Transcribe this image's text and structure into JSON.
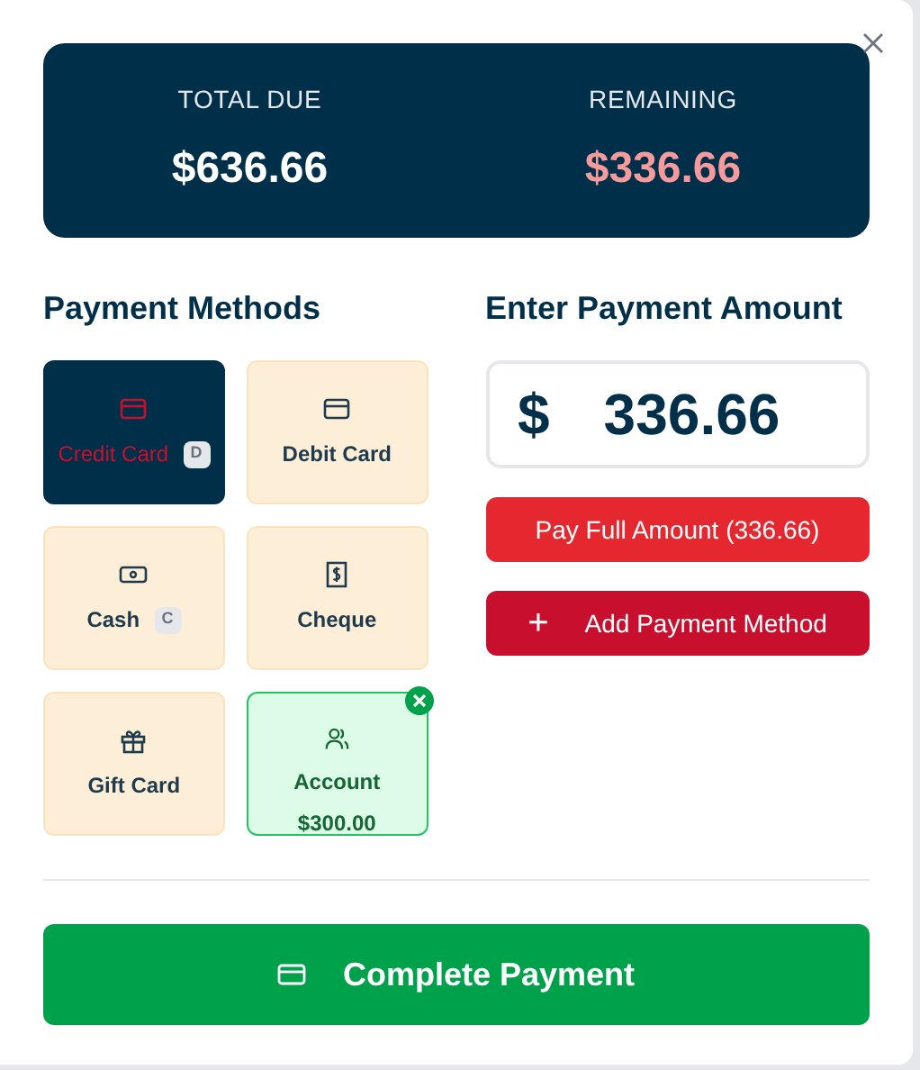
{
  "summary": [
    {
      "label": "TOTAL DUE",
      "value": "$636.66",
      "kind": "total"
    },
    {
      "label": "REMAINING",
      "value": "$336.66",
      "kind": "remaining"
    }
  ],
  "methods_title": "Payment Methods",
  "methods": [
    {
      "kind": "credit",
      "label": "Credit Card",
      "shortcut": "D",
      "selected": true,
      "added": false
    },
    {
      "kind": "debit",
      "label": "Debit Card",
      "selected": false,
      "added": false
    },
    {
      "kind": "cash",
      "label": "Cash",
      "shortcut": "C",
      "selected": false,
      "added": false
    },
    {
      "kind": "cheque",
      "label": "Cheque",
      "selected": false,
      "added": false
    },
    {
      "kind": "gift",
      "label": "Gift Card",
      "selected": false,
      "added": false
    },
    {
      "kind": "account",
      "label": "Account",
      "amount": "$300.00",
      "selected": false,
      "added": true
    }
  ],
  "amount_title": "Enter Payment Amount",
  "amount": {
    "currency": "$",
    "value": "336.66"
  },
  "pay_full_button": "Pay Full Amount (336.66)",
  "add_method_button": {
    "icon": "+",
    "label": "Add Payment Method"
  },
  "complete_button": "Complete Payment"
}
